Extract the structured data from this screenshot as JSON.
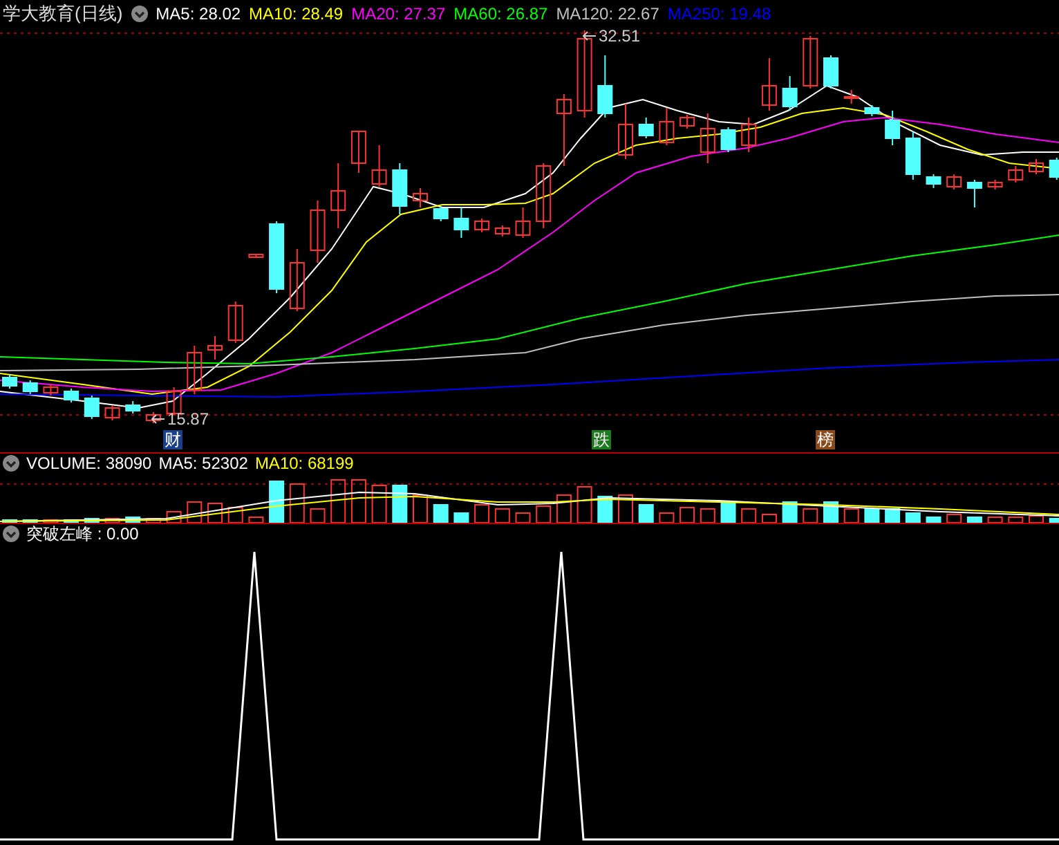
{
  "window": {
    "title": "学大教育(日线)"
  },
  "price_panel": {
    "legend": [
      {
        "label": "MA5: 28.02",
        "color": "#ffffff"
      },
      {
        "label": "MA10: 28.49",
        "color": "#ffff00"
      },
      {
        "label": "MA20: 27.37",
        "color": "#ff00ff"
      },
      {
        "label": "MA60: 26.87",
        "color": "#00ff00"
      },
      {
        "label": "MA120: 22.67",
        "color": "#c0c0c0"
      },
      {
        "label": "MA250: 19.48",
        "color": "#0000ff"
      }
    ],
    "annotations": [
      {
        "kind": "high",
        "text": "32.51"
      },
      {
        "kind": "low",
        "text": "15.87"
      }
    ],
    "event_markers": [
      {
        "text": "财",
        "color": "#1c3f8c"
      },
      {
        "text": "跌",
        "color": "#1e7a1e"
      },
      {
        "text": "榜",
        "color": "#8a4a1a"
      }
    ]
  },
  "volume_panel": {
    "legend": [
      {
        "label": "VOLUME: 38090",
        "color": "#ffffff"
      },
      {
        "label": "MA5: 52302",
        "color": "#ffffff"
      },
      {
        "label": "MA10: 68199",
        "color": "#ffff00"
      }
    ]
  },
  "indicator_panel": {
    "legend": [
      {
        "label": "突破左峰 : 0.00",
        "color": "#ffffff"
      }
    ]
  }
}
